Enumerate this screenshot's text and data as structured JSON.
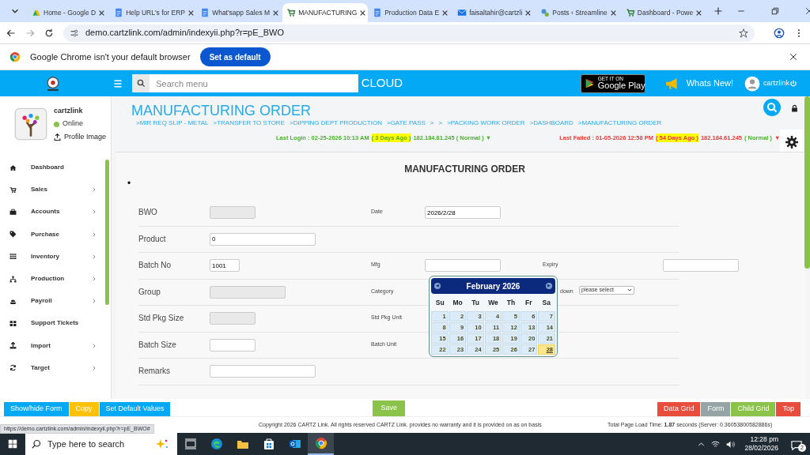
{
  "browser": {
    "tabs": [
      {
        "title": "Home - Google D",
        "selected": false
      },
      {
        "title": "Help URL's for ERP",
        "selected": false
      },
      {
        "title": "What'sapp Sales M",
        "selected": false
      },
      {
        "title": "MANUFACTURING",
        "selected": true
      },
      {
        "title": "Production Data E",
        "selected": false
      },
      {
        "title": "faisaltahir@cartzli",
        "selected": false
      },
      {
        "title": "Posts ‹ Streamline",
        "selected": false
      },
      {
        "title": "Dashboard - Powe",
        "selected": false
      }
    ],
    "url": "demo.cartzlink.com/admin/indexyii.php?r=pE_BWO",
    "infobar": {
      "message": "Google Chrome isn't your default browser",
      "button": "Set as default"
    }
  },
  "header": {
    "search_placeholder": "Search menu",
    "cloud": "CLOUD",
    "store_badge": {
      "small": "GET IT ON",
      "large": "Google Play"
    },
    "whats_new": "Whats New!",
    "user": "cartzlink"
  },
  "profile": {
    "name": "cartzlink",
    "status": "Online",
    "online": true,
    "link": "Profile Image"
  },
  "sidebar": {
    "items": [
      {
        "label": "Dashboard",
        "expandable": false
      },
      {
        "label": "Sales",
        "expandable": true
      },
      {
        "label": "Accounts",
        "expandable": true
      },
      {
        "label": "Purchase",
        "expandable": true
      },
      {
        "label": "Inventory",
        "expandable": true
      },
      {
        "label": "Production",
        "expandable": true
      },
      {
        "label": "Payroll",
        "expandable": true
      },
      {
        "label": "Support Tickets",
        "expandable": false
      },
      {
        "label": "Import",
        "expandable": true
      },
      {
        "label": "Target",
        "expandable": true
      }
    ]
  },
  "page": {
    "title": "MANUFACTURING ORDER",
    "breadcrumbs": [
      ">MIR REQ SLIP - METAL",
      ">TRANSFER TO STORE",
      ">DIPPING DEPT PRODUCTION",
      ">GATE PASS",
      ">",
      ">",
      ">PACKING WORK ORDER",
      ">DASHBOARD",
      ">MANUFACTURING ORDER"
    ],
    "last_login": [
      {
        "text": "Last Login : 02-25-2026 10:13 AM",
        "highlight": false
      },
      {
        "text": "( 3 Days Ago )",
        "highlight": true
      },
      {
        "text": "182.184.61.245 ( Normal ) ▼",
        "highlight": false
      }
    ],
    "last_failed": [
      {
        "text": "Last Failed : 01-05-2026 12:58 PM",
        "highlight": false
      },
      {
        "text": "( 54 Days Ago )",
        "highlight": true
      },
      {
        "text": "182.184.61.245",
        "highlight": false
      },
      {
        "text": "( Normal )",
        "highlight": false,
        "green": true
      },
      {
        "text": "▼",
        "highlight": false
      }
    ]
  },
  "form": {
    "heading": "MANUFACTURING ORDER",
    "bullet": "•",
    "rows": [
      {
        "cells": [
          {
            "label": "BWO",
            "kind": "input",
            "disabled": true
          },
          {
            "label": "Date",
            "kind": "input",
            "value": "2026/2/28",
            "disabled": false
          }
        ]
      },
      {
        "cells": [
          {
            "label": "Product",
            "kind": "input",
            "value": "0",
            "disabled": false
          }
        ]
      },
      {
        "cells": [
          {
            "label": "Batch No",
            "kind": "input",
            "value": "1001",
            "disabled": false
          },
          {
            "label": "Mfg",
            "kind": "input",
            "disabled": false,
            "focused": true
          },
          {
            "label": "Expiry",
            "kind": "input",
            "disabled": false
          }
        ]
      },
      {
        "cells": [
          {
            "label": "Group",
            "kind": "input",
            "disabled": true
          },
          {
            "label": "Category",
            "kind": "none"
          },
          {
            "label": "down",
            "kind": "select",
            "value": "please select"
          }
        ]
      },
      {
        "cells": [
          {
            "label": "Std Pkg Size",
            "kind": "input",
            "disabled": true
          },
          {
            "label": "Std Pkg Unit",
            "kind": "none"
          }
        ]
      },
      {
        "cells": [
          {
            "label": "Batch Size",
            "kind": "input",
            "disabled": false
          },
          {
            "label": "Batch Unit",
            "kind": "none"
          }
        ]
      },
      {
        "cells": [
          {
            "label": "Remarks",
            "kind": "input",
            "disabled": false
          }
        ]
      }
    ]
  },
  "calendar": {
    "title": "February 2026",
    "prev": "◀",
    "next": "▶",
    "weekdays": [
      "Su",
      "Mo",
      "Tu",
      "We",
      "Th",
      "Fr",
      "Sa"
    ],
    "days": [
      {
        "day": "1",
        "selected": false
      },
      {
        "day": "2",
        "selected": false
      },
      {
        "day": "3",
        "selected": false
      },
      {
        "day": "4",
        "selected": false
      },
      {
        "day": "5",
        "selected": false
      },
      {
        "day": "6",
        "selected": false
      },
      {
        "day": "7",
        "selected": false
      },
      {
        "day": "8",
        "selected": false
      },
      {
        "day": "9",
        "selected": false
      },
      {
        "day": "10",
        "selected": false
      },
      {
        "day": "11",
        "selected": false
      },
      {
        "day": "12",
        "selected": false
      },
      {
        "day": "13",
        "selected": false
      },
      {
        "day": "14",
        "selected": false
      },
      {
        "day": "15",
        "selected": false
      },
      {
        "day": "16",
        "selected": false
      },
      {
        "day": "17",
        "selected": false
      },
      {
        "day": "18",
        "selected": false
      },
      {
        "day": "19",
        "selected": false
      },
      {
        "day": "20",
        "selected": false
      },
      {
        "day": "21",
        "selected": false
      },
      {
        "day": "22",
        "selected": false
      },
      {
        "day": "23",
        "selected": false
      },
      {
        "day": "24",
        "selected": false
      },
      {
        "day": "25",
        "selected": false
      },
      {
        "day": "26",
        "selected": false
      },
      {
        "day": "27",
        "selected": false
      },
      {
        "day": "28",
        "selected": true
      }
    ]
  },
  "actions": {
    "left": [
      {
        "label": "Show/hide Form",
        "color": "#03a9f4"
      },
      {
        "label": "Copy",
        "color": "#ffc107"
      },
      {
        "label": "Set Default Values",
        "color": "#03a9f4"
      }
    ],
    "center": {
      "label": "Save",
      "color": "#8bc34a"
    },
    "right": [
      {
        "label": "Data Grid",
        "color": "#e74c3c"
      },
      {
        "label": "Form",
        "color": "#95a5a6"
      },
      {
        "label": "Child Grid",
        "color": "#8bc34a"
      },
      {
        "label": "Top",
        "color": "#e74c3c"
      }
    ]
  },
  "footer": {
    "status_url": "https://demo.cartzlink.com/admin/indexyii.php?r=pE_BWO#",
    "copyright": "Copyright 2026 CARTZ Link. All rights reserved CARTZ Link. provides no warranty and it is provided on as on basis",
    "load_time": "Total Page Load Time: **1.87** seconds (Server: 0.36053800582886s)"
  },
  "taskbar": {
    "search_placeholder": "Type here to search",
    "time": "12:28 pm",
    "date": "28/02/2026",
    "notifications": "2"
  }
}
